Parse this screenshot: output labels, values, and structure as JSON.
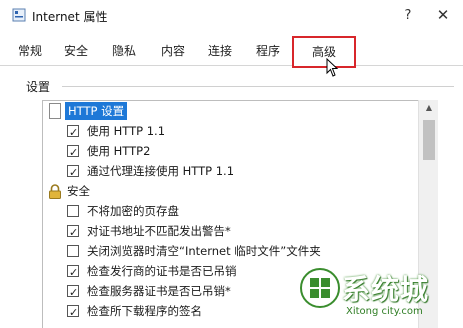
{
  "window": {
    "title": "Internet 属性",
    "help_label": "?",
    "close_label": "✕"
  },
  "tabs": [
    {
      "label": "常规"
    },
    {
      "label": "安全"
    },
    {
      "label": "隐私"
    },
    {
      "label": "内容"
    },
    {
      "label": "连接"
    },
    {
      "label": "程序"
    },
    {
      "label": "高级",
      "active": true
    }
  ],
  "settings": {
    "group_label": "设置",
    "items": [
      {
        "type": "group",
        "icon": "document-icon",
        "label": "HTTP 设置",
        "selected": true
      },
      {
        "type": "checkbox",
        "label": "使用 HTTP 1.1",
        "checked": true
      },
      {
        "type": "checkbox",
        "label": "使用 HTTP2",
        "checked": true
      },
      {
        "type": "checkbox",
        "label": "通过代理连接使用 HTTP 1.1",
        "checked": true
      },
      {
        "type": "group",
        "icon": "lock-icon",
        "label": "安全",
        "selected": false
      },
      {
        "type": "checkbox",
        "label": "不将加密的页存盘",
        "checked": false
      },
      {
        "type": "checkbox",
        "label": "对证书地址不匹配发出警告*",
        "checked": true
      },
      {
        "type": "checkbox",
        "label": "关闭浏览器时清空“Internet 临时文件”文件夹",
        "checked": false
      },
      {
        "type": "checkbox",
        "label": "检查发行商的证书是否已吊销",
        "checked": true
      },
      {
        "type": "checkbox",
        "label": "检查服务器证书是否已吊销*",
        "checked": true
      },
      {
        "type": "checkbox",
        "label": "检查所下载程序的签名",
        "checked": true
      }
    ]
  },
  "watermark": {
    "text": "系统城",
    "subtext": "Xitong city.com"
  },
  "colors": {
    "selection": "#1e78d7",
    "highlight_box": "#d8262b",
    "watermark_green": "#3a8d2e"
  }
}
